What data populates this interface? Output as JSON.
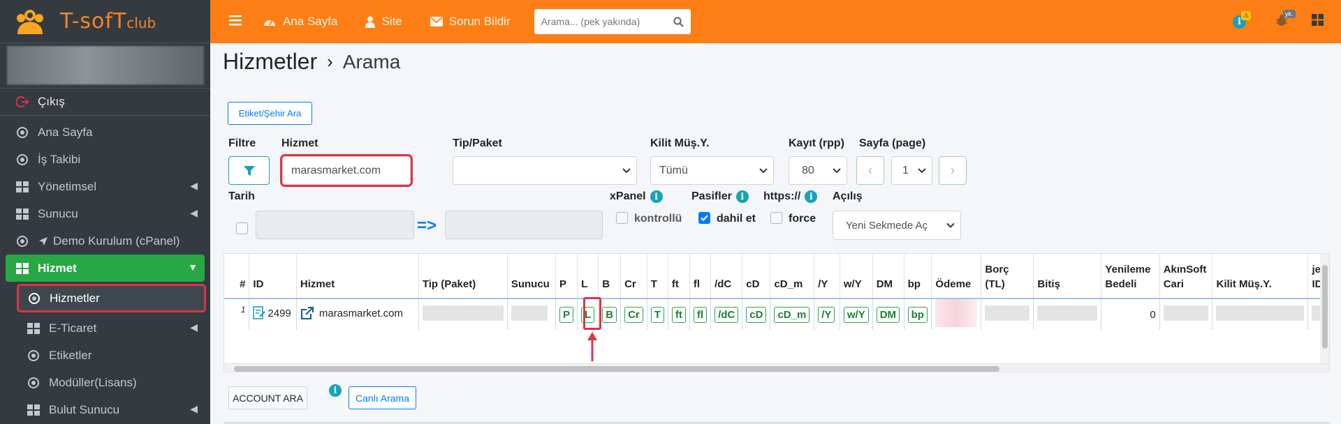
{
  "brand": {
    "name": "T-sofT",
    "suffix": "club"
  },
  "sidebar": {
    "logout": "Çıkış",
    "items": [
      {
        "label": "Ana Sayfa",
        "icon": "circle-icon"
      },
      {
        "label": "İş Takibi",
        "icon": "circle-icon"
      },
      {
        "label": "Yönetimsel",
        "icon": "grid-icon"
      },
      {
        "label": "Sunucu",
        "icon": "grid-icon"
      },
      {
        "label": "Demo Kurulum (cPanel)",
        "icon": "paper-plane-icon"
      },
      {
        "label": "Hizmet",
        "icon": "grid-icon"
      },
      {
        "label": "Hizmetler",
        "icon": "circle-icon"
      },
      {
        "label": "E-Ticaret",
        "icon": "grid-icon"
      },
      {
        "label": "Etiketler",
        "icon": "circle-icon"
      },
      {
        "label": "Modüller(Lisans)",
        "icon": "circle-icon"
      },
      {
        "label": "Bulut Sunucu",
        "icon": "grid-icon"
      }
    ]
  },
  "topbar": {
    "home": "Ana Sayfa",
    "site": "Site",
    "report": "Sorun Bildir",
    "search_placeholder": "Arama... (pek yakında)",
    "badge_warn": "⚠",
    "badge_yk": "yk."
  },
  "page": {
    "title": "Hizmetler",
    "sub": "Arama",
    "sep": "›"
  },
  "filters": {
    "tag_search": "Etiket/Şehir Ara",
    "filtre": "Filtre",
    "hizmet": "Hizmet",
    "hizmet_value": "marasmarket.com",
    "tip_paket": "Tip/Paket",
    "kilit": "Kilit Müş.Y.",
    "kilit_value": "Tümü",
    "kayit": "Kayıt (rpp)",
    "kayit_value": "80",
    "sayfa": "Sayfa (page)",
    "sayfa_value": "1",
    "prev": "‹",
    "next": "›",
    "tarih": "Tarih",
    "arrow": "=>",
    "xpanel": "xPanel",
    "pasifler": "Pasifler",
    "https": "https://",
    "acilis": "Açılış",
    "kontrollu": "kontrollü",
    "dahil_et": "dahil et",
    "force": "force",
    "acilis_value": "Yeni Sekmede Aç"
  },
  "table": {
    "headers": [
      "#",
      "ID",
      "Hizmet",
      "Tip (Paket)",
      "Sunucu",
      "P",
      "L",
      "B",
      "Cr",
      "T",
      "ft",
      "fl",
      "/dC",
      "cD",
      "cD_m",
      "/Y",
      "w/Y",
      "DM",
      "bp",
      "Ödeme",
      "Borç (TL)",
      "Bitiş",
      "Yenileme Bedeli",
      "AkınSoft Cari",
      "Kilit Müş.Y.",
      "je ID"
    ],
    "row": {
      "num": "1",
      "id": "2499",
      "hizmet": "marasmarket.com",
      "codes": [
        "P",
        "L",
        "B",
        "Cr",
        "T",
        "ft",
        "fl",
        "/dC",
        "cD",
        "cD_m",
        "/Y",
        "w/Y",
        "DM",
        "bp"
      ],
      "yenileme": "0"
    }
  },
  "bottom": {
    "account_ara": "ACCOUNT ARA",
    "canli": "Canlı Arama"
  },
  "colors": {
    "topbar": "#fd7e14",
    "sidebar": "#343a40",
    "active": "#28a745",
    "highlight": "#dc3545"
  }
}
